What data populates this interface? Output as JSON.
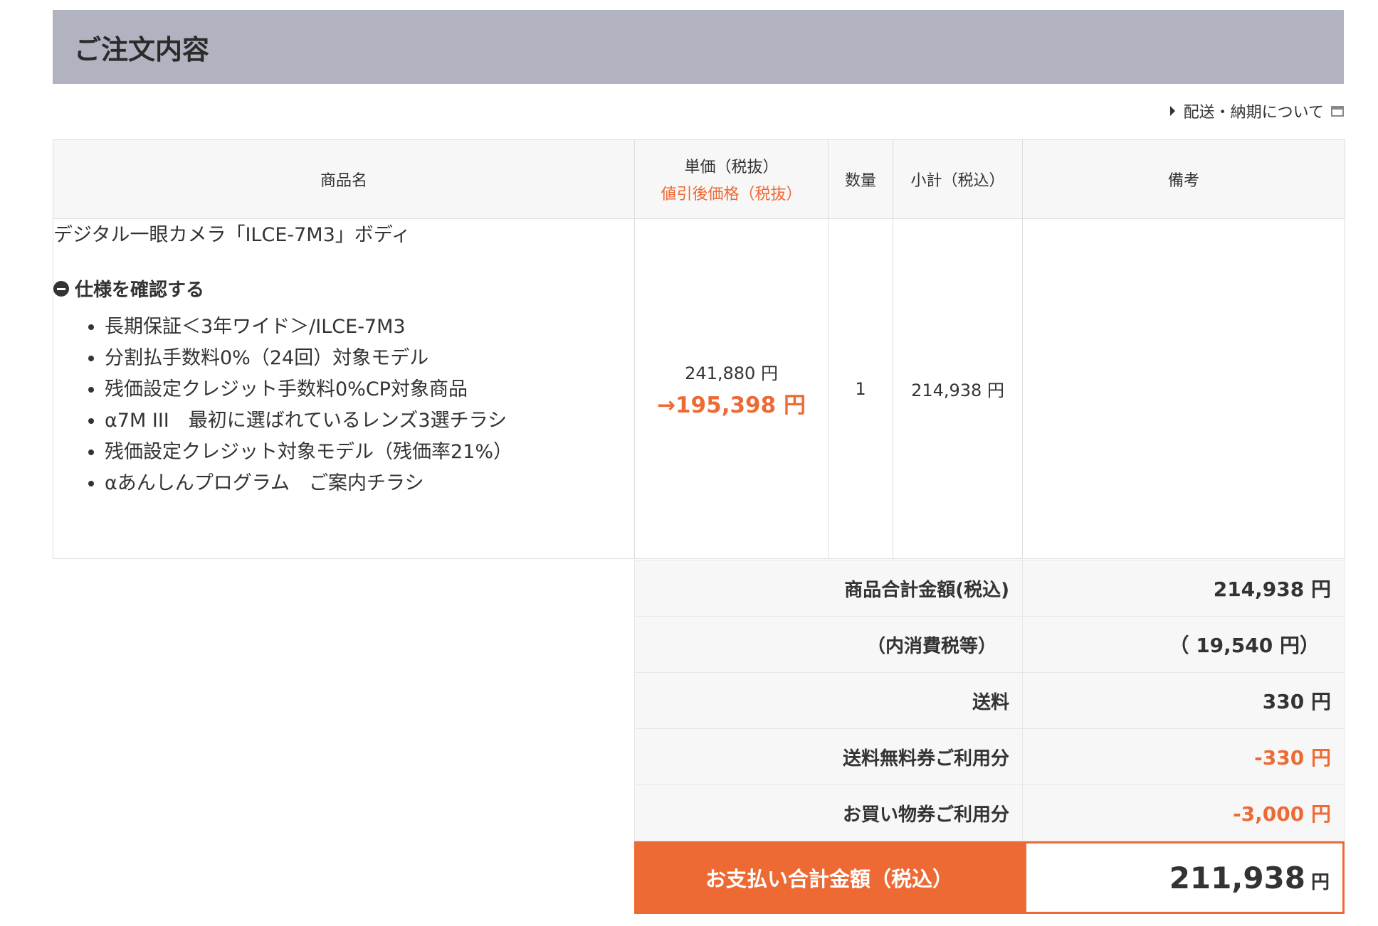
{
  "header": {
    "title": "ご注文内容"
  },
  "delivery_link": {
    "label": "配送・納期について"
  },
  "table": {
    "headers": {
      "product": "商品名",
      "unit_price": "単価（税抜）",
      "discount_price": "値引後価格（税抜）",
      "quantity": "数量",
      "subtotal": "小計（税込）",
      "remarks": "備考"
    },
    "item": {
      "name": "デジタル一眼カメラ「ILCE-7M3」ボディ",
      "spec_toggle": "仕様を確認する",
      "specs": [
        "長期保証＜3年ワイド＞/ILCE-7M3",
        "分割払手数料0%（24回）対象モデル",
        "残価設定クレジット手数料0%CP対象商品",
        "α7M III　最初に選ばれているレンズ3選チラシ",
        "残価設定クレジット対象モデル（残価率21%）",
        "αあんしんプログラム　ご案内チラシ"
      ],
      "unit_price": "241,880 円",
      "discount_price": "→195,398 円",
      "quantity": "1",
      "subtotal": "214,938 円",
      "remarks": ""
    }
  },
  "summary": {
    "rows": [
      {
        "label": "商品合計金額(税込)",
        "value": "214,938 円"
      },
      {
        "label": "（内消費税等）",
        "value": "（ 19,540 円）"
      },
      {
        "label": "送料",
        "value": "330 円"
      },
      {
        "label": "送料無料券ご利用分",
        "value": "-330 円"
      },
      {
        "label": "お買い物券ご利用分",
        "value": "-3,000 円"
      }
    ],
    "total": {
      "label": "お支払い合計金額（税込）",
      "value": "211,938",
      "unit": "円"
    }
  },
  "colors": {
    "accent": "#ee6a35",
    "header_bg": "#b2b3c0"
  }
}
